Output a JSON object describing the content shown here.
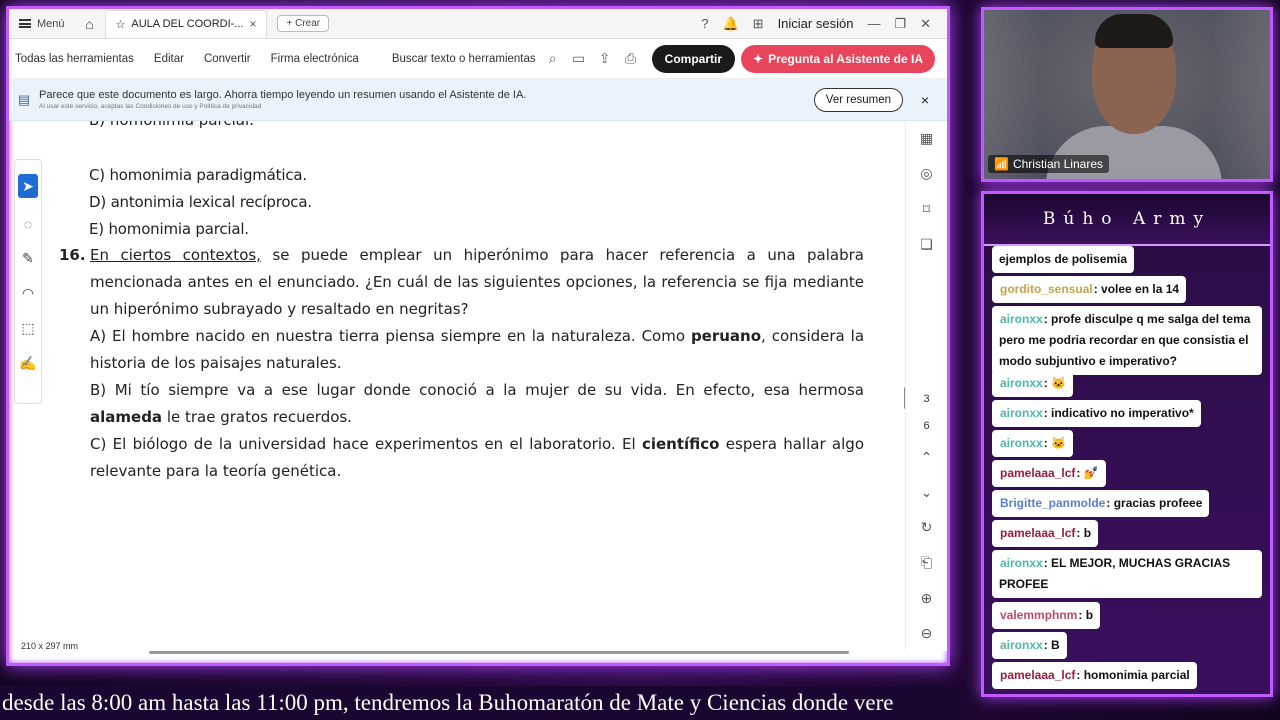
{
  "tabbar": {
    "menu_label": "Menú",
    "tab_title": "AULA DEL COORDI-...",
    "create_label": "Crear",
    "signin_label": "Iniciar sesión"
  },
  "toolbar": {
    "all_tools": "Todas las herramientas",
    "edit": "Editar",
    "convert": "Convertir",
    "esign": "Firma electrónica",
    "search": "Buscar texto o herramientas",
    "share": "Compartir",
    "ai_button": "Pregunta al Asistente de IA"
  },
  "banner": {
    "message": "Parece que este documento es largo. Ahorra tiempo leyendo un resumen usando el Asistente de IA.",
    "subtext": "Al usar este servicio, aceptas las Condiciones de uso y Política de privacidad",
    "button": "Ver resumen",
    "close": "×"
  },
  "document": {
    "cut_line": "B) homonimia parcial.",
    "options_prev": [
      "C) homonimia paradigmática.",
      "D) antonimia lexical recíproca.",
      "E) homonimia parcial."
    ],
    "q_number": "16.",
    "q_underlined": "En ciertos contextos,",
    "q_text": " se puede emplear un hiperónimo para hacer referencia a una palabra mencionada antes en el enunciado. ¿En cuál de las siguientes opciones, la referencia se fija mediante un hiperónimo subrayado y resaltado en negritas?",
    "optA_pre": "A) El hombre nacido en nuestra tierra piensa siempre en la naturaleza. Como ",
    "optA_bold": "peruano",
    "optA_post": ", considera la historia de los paisajes naturales.",
    "optB_pre": "B) Mi tío siempre va a ese lugar donde conoció a la mujer de su vida. En efecto, esa hermosa ",
    "optB_bold": "alameda",
    "optB_post": " le trae gratos recuerdos.",
    "optC_pre": "C) El biólogo de la universidad hace experimentos en el laboratorio. El ",
    "optC_bold": "científico",
    "optC_post": " espera hallar algo relevante para la teoría genética.",
    "page_size": "210 x 297 mm",
    "page_current": "3",
    "page_total": "6"
  },
  "webcam": {
    "name": "Christian Linares"
  },
  "chat": {
    "title": "Búho Army",
    "messages": [
      {
        "user": "",
        "text": "ejemplos de polisemia",
        "color": "#000000"
      },
      {
        "user": "gordito_sensual",
        "text": ": volee en la 14",
        "color": "#c8a24a"
      },
      {
        "user": "aironxx",
        "text": ": profe disculpe q me salga del tema pero me podria recordar en que consistia el modo subjuntivo e imperativo?",
        "color": "#4fb7a8"
      },
      {
        "user": "aironxx",
        "text": ": 🐱",
        "color": "#4fb7a8"
      },
      {
        "user": "aironxx",
        "text": ": indicativo no imperativo*",
        "color": "#4fb7a8"
      },
      {
        "user": "aironxx",
        "text": ": 🐱",
        "color": "#4fb7a8"
      },
      {
        "user": "pamelaaa_lcf",
        "text": ": 💅",
        "color": "#9b1c3c"
      },
      {
        "user": "Brigitte_panmolde",
        "text": ": gracias profeee",
        "color": "#5b7fd0"
      },
      {
        "user": "pamelaaa_lcf",
        "text": ": b",
        "color": "#9b1c3c"
      },
      {
        "user": "aironxx",
        "text": ": EL MEJOR, MUCHAS GRACIAS PROFEE",
        "color": "#4fb7a8"
      },
      {
        "user": "valemmphnm",
        "text": ": b",
        "color": "#c04a6a"
      },
      {
        "user": "aironxx",
        "text": ": B",
        "color": "#4fb7a8"
      },
      {
        "user": "pamelaaa_lcf",
        "text": ": homonimia parcial",
        "color": "#9b1c3c"
      }
    ]
  },
  "ticker": {
    "text": "desde las 8:00 am hasta las 11:00 pm, tendremos la Buhomaratón de Mate y Ciencias donde vere"
  }
}
